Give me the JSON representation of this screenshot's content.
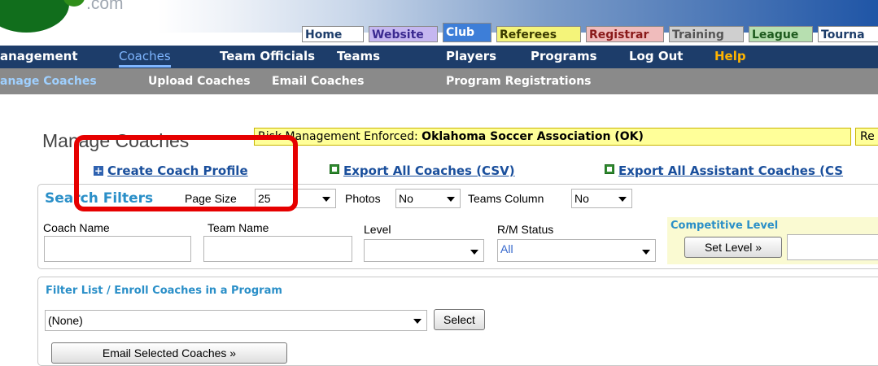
{
  "header": {
    "logo_text": ".com",
    "tabs": [
      {
        "label": "Home",
        "bg": "#ffffff",
        "color": "#1d3d6a"
      },
      {
        "label": "Website",
        "bg": "#c5b7f0",
        "color": "#3b2a90"
      },
      {
        "label": "Club",
        "bg": "#3d7ed8",
        "color": "#ffffff"
      },
      {
        "label": "Referees",
        "bg": "#f4f47a",
        "color": "#3b3b00"
      },
      {
        "label": "Registrar",
        "bg": "#f0bcbc",
        "color": "#8a1a1a"
      },
      {
        "label": "Training",
        "bg": "#cfcfcf",
        "color": "#555555"
      },
      {
        "label": "League",
        "bg": "#b7dfb0",
        "color": "#1d5a1d"
      },
      {
        "label": "Tourna",
        "bg": "#ffffff",
        "color": "#1d3d6a"
      }
    ]
  },
  "nav1": {
    "items": [
      "anagement",
      "Coaches",
      "Team Officials",
      "Teams",
      "Players",
      "Programs",
      "Log Out",
      "Help"
    ],
    "active": "Coaches",
    "help_color": "#ffb400",
    "active_color": "#7fb6ff"
  },
  "nav2": {
    "items": [
      "anage Coaches",
      "Upload Coaches",
      "Email Coaches",
      "Program Registrations"
    ],
    "active_color": "#9fd0ff"
  },
  "page": {
    "title": "Manage Coaches",
    "risk_label": "Risk Management Enforced:",
    "risk_org": "Oklahoma Soccer Association (OK)",
    "re_text": "Re",
    "links": {
      "create": "Create Coach Profile",
      "export_all": "Export All Coaches (CSV)",
      "export_assistant": "Export All Assistant Coaches (CS"
    }
  },
  "filters": {
    "title": "Search Filters",
    "page_size_label": "Page Size",
    "page_size_value": "25",
    "photos_label": "Photos",
    "photos_value": "No",
    "teams_column_label": "Teams Column",
    "teams_column_value": "No",
    "coach_name_label": "Coach Name",
    "team_name_label": "Team Name",
    "level_label": "Level",
    "rm_status_label": "R/M Status",
    "rm_status_value": "All",
    "competitive_level_label": "Competitive Level",
    "set_level_label": "Set Level »"
  },
  "enroll": {
    "title": "Filter List / Enroll Coaches in a Program",
    "program_value": "(None)",
    "select_label": "Select",
    "email_label": "Email Selected Coaches »"
  },
  "colors": {
    "link_blue": "#1a4f9c",
    "filter_title": "#2a8fc8",
    "highlight": "#e60000"
  }
}
